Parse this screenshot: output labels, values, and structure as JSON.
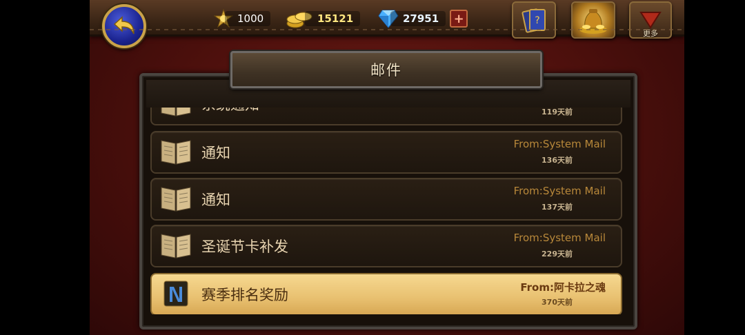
{
  "top_bar": {
    "level_value": "1000",
    "gold_value": "15121",
    "gem_value": "27951",
    "plus_label": "+",
    "more_label": "更多"
  },
  "mail": {
    "title": "邮件",
    "items": [
      {
        "subject": "系统通知",
        "from": "",
        "age": "119天前",
        "icon": "book-icon",
        "active": false
      },
      {
        "subject": "通知",
        "from": "From:System Mail",
        "age": "136天前",
        "icon": "book-icon",
        "active": false
      },
      {
        "subject": "通知",
        "from": "From:System Mail",
        "age": "137天前",
        "icon": "book-icon",
        "active": false
      },
      {
        "subject": "圣诞节卡补发",
        "from": "From:System Mail",
        "age": "229天前",
        "icon": "book-icon",
        "active": false
      },
      {
        "subject": "赛季排名奖励",
        "from": "From:阿卡拉之魂",
        "age": "370天前",
        "icon": "scroll-icon",
        "active": true
      }
    ]
  }
}
